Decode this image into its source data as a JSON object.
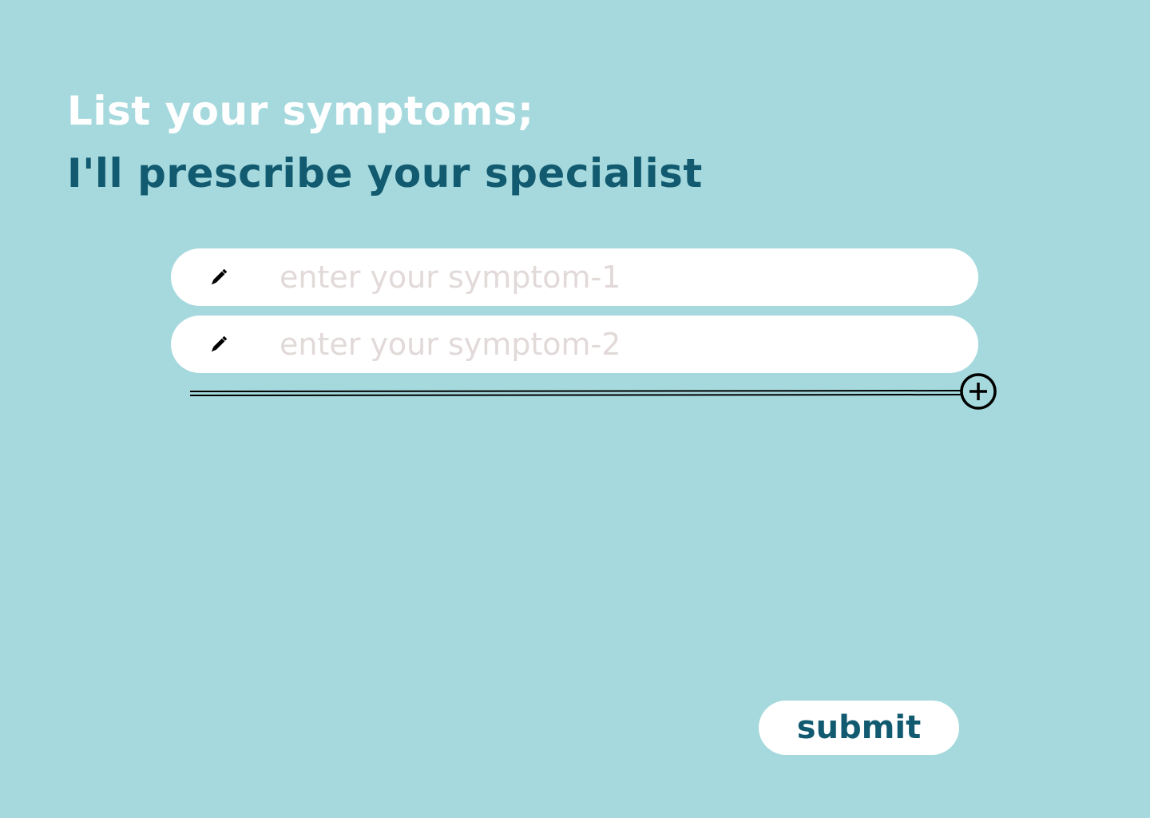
{
  "header": {
    "line1": "List your symptoms;",
    "line2": "I'll prescribe your specialist"
  },
  "symptoms": {
    "fields": [
      {
        "placeholder": "enter your symptom-1",
        "value": "",
        "icon": "pencil-icon"
      },
      {
        "placeholder": "enter your symptom-2",
        "value": "",
        "icon": "pencil-icon"
      }
    ],
    "add_icon": "plus-circle-icon"
  },
  "submit": {
    "label": "submit"
  },
  "colors": {
    "background": "#a5d9dd",
    "heading_light": "#ffffff",
    "heading_dark": "#115a70",
    "placeholder": "#e2d9d9",
    "field_background": "#ffffff"
  }
}
